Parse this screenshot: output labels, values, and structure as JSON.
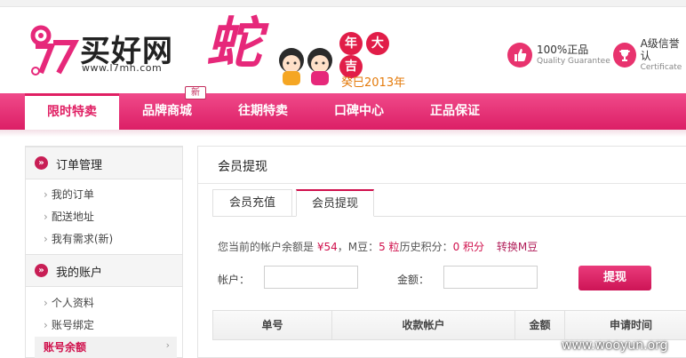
{
  "logo": {
    "wordmark": "买好网",
    "url": "www.l7mh.com",
    "mark": "17"
  },
  "banner": {
    "big_char": "蛇",
    "year_chars": [
      "年",
      "大",
      "吉"
    ],
    "sub": "癸巳2013年"
  },
  "badges": [
    {
      "title": "100%正品",
      "sub": "Quality Guarantee",
      "icon": "thumbs-up-icon"
    },
    {
      "title": "A级信誉认",
      "sub": "Certificate",
      "icon": "trophy-icon"
    }
  ],
  "nav": {
    "items": [
      {
        "label": "限时特卖",
        "active": true
      },
      {
        "label": "品牌商城",
        "active": false
      },
      {
        "label": "往期特卖",
        "active": false
      },
      {
        "label": "口碑中心",
        "active": false
      },
      {
        "label": "正品保证",
        "active": false
      }
    ],
    "new_tag": "新"
  },
  "sidebar": {
    "sections": [
      {
        "title": "订单管理",
        "items": [
          "我的订单",
          "配送地址",
          "我有需求(新)"
        ]
      },
      {
        "title": "我的账户",
        "items": [
          "个人资料",
          "账号绑定"
        ]
      }
    ],
    "active_item": "账号余额",
    "active_arrow": "›",
    "bullet": "›",
    "head_icon": "»"
  },
  "main": {
    "title": "会员提现",
    "tabs": [
      {
        "label": "会员充值",
        "active": false
      },
      {
        "label": "会员提现",
        "active": true
      }
    ],
    "info": {
      "balance_prefix": "您当前的帐户余额是",
      "balance_value": "¥54",
      "beans_prefix": "，M豆：",
      "beans_value": "5 粒",
      "points_prefix": "历史积分：",
      "points_value": "0 积分",
      "convert_link": "转换M豆"
    },
    "form": {
      "account_label": "帐户：",
      "account_value": "",
      "amount_label": "金额：",
      "amount_value": "",
      "submit_label": "提现"
    },
    "table": {
      "columns": [
        "单号",
        "收款帐户",
        "金额",
        "申请时间"
      ]
    }
  },
  "watermark": "www.wooyun.org",
  "colors": {
    "brand": "#e01f63",
    "nav_gradient_top": "#f04a8a",
    "nav_gradient_bottom": "#dc1f66",
    "link": "#b11f5a"
  }
}
